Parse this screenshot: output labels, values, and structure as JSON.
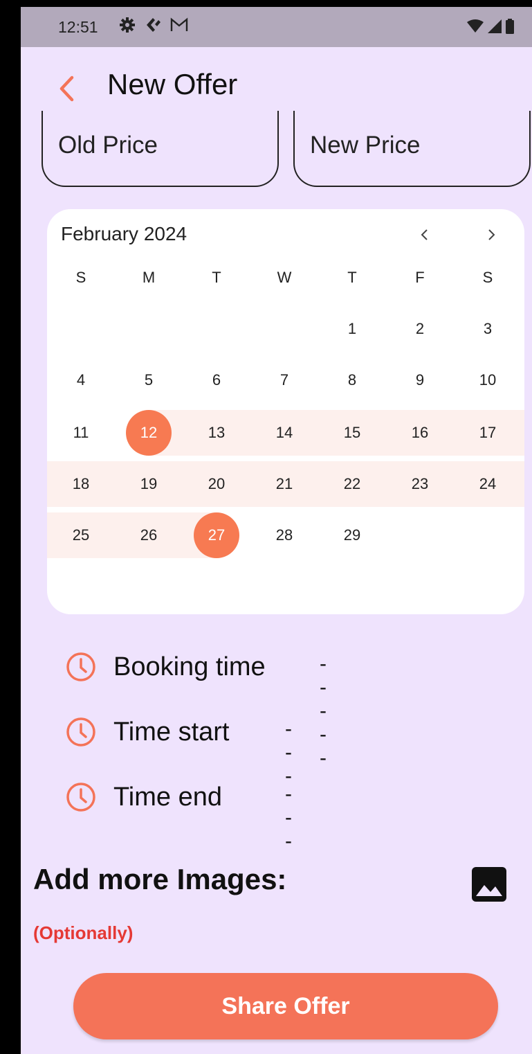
{
  "status_bar": {
    "time": "12:51",
    "left_icons": [
      "gear-icon",
      "app-icon",
      "gmail-icon"
    ],
    "right_icons": [
      "wifi-icon",
      "signal-icon",
      "battery-icon"
    ]
  },
  "app_bar": {
    "title": "New Offer",
    "back_icon": "chevron-left-icon",
    "accent_color": "#f47358"
  },
  "price_fields": {
    "old_price_placeholder": "Old Price",
    "new_price_placeholder": "New Price"
  },
  "calendar": {
    "month_label": "February 2024",
    "weekdays": [
      "S",
      "M",
      "T",
      "W",
      "T",
      "F",
      "S"
    ],
    "weeks": [
      [
        "",
        "",
        "",
        "",
        "1",
        "2",
        "3"
      ],
      [
        "4",
        "5",
        "6",
        "7",
        "8",
        "9",
        "10"
      ],
      [
        "11",
        "12",
        "13",
        "14",
        "15",
        "16",
        "17"
      ],
      [
        "18",
        "19",
        "20",
        "21",
        "22",
        "23",
        "24"
      ],
      [
        "25",
        "26",
        "27",
        "28",
        "29",
        "",
        ""
      ]
    ],
    "range_start": "12",
    "range_end": "27",
    "selected_color": "#f77a52",
    "range_color": "#fdf0ed"
  },
  "times": {
    "booking_label": "Booking time",
    "booking_value": "-----",
    "start_label": "Time start",
    "start_value": "---",
    "end_label": "Time end",
    "end_value": "---",
    "icon": "clock-icon"
  },
  "images": {
    "title": "Add more Images:",
    "optional_note": "(Optionally)",
    "icon": "image-icon"
  },
  "share_button": {
    "label": "Share Offer"
  }
}
